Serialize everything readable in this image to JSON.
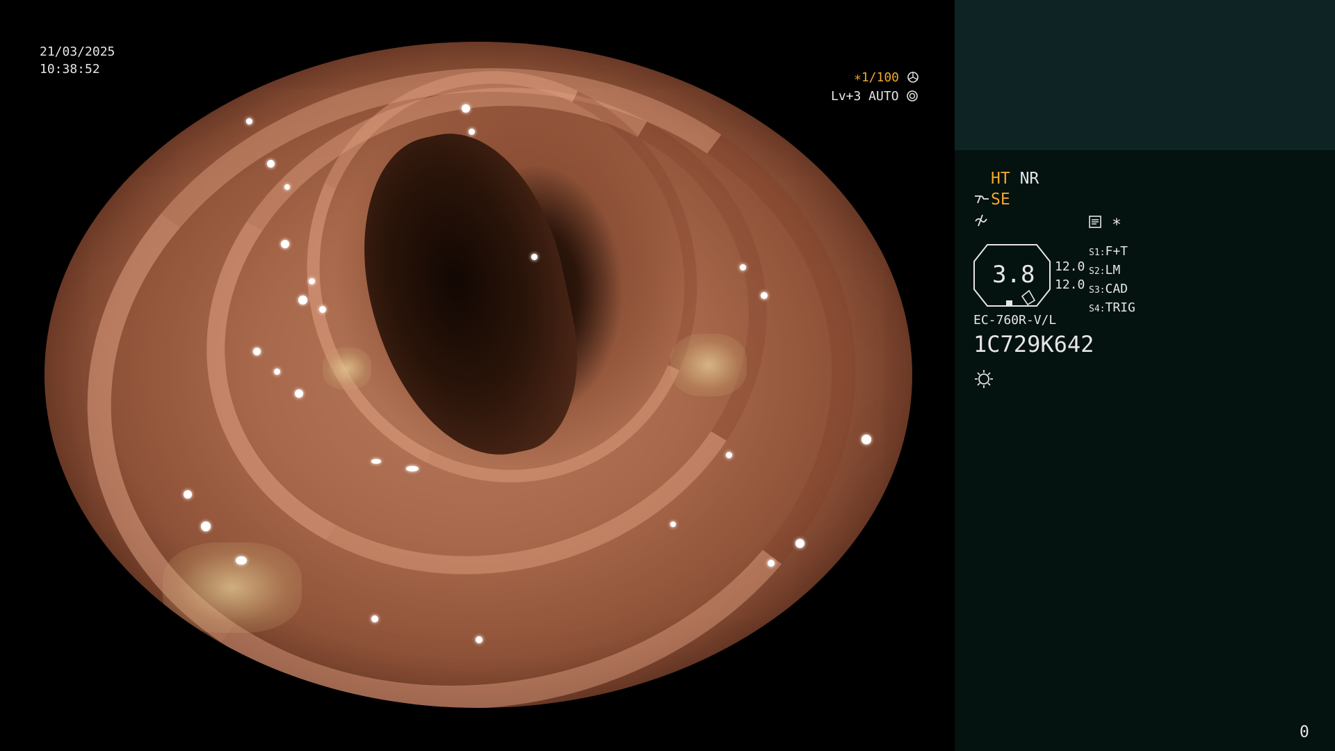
{
  "overlay": {
    "date": "21/03/2025",
    "time": "10:38:52",
    "shutter": "∗1/100",
    "level": "Lv+3 AUTO"
  },
  "panel": {
    "ht": "HT",
    "nr": "NR",
    "se": "SE",
    "gauge_value": "3.8",
    "value_top": "12.0",
    "value_bottom": "12.0",
    "switches": [
      {
        "key": "S1:",
        "value": "F+T"
      },
      {
        "key": "S2:",
        "value": "LM"
      },
      {
        "key": "S3:",
        "value": "CAD"
      },
      {
        "key": "S4:",
        "value": "TRIG"
      }
    ],
    "scope_model": "EC-760R-V/L",
    "serial": "1C729K642",
    "counter": "0"
  },
  "colors": {
    "accent": "#f2a72c",
    "panel_bg": "#041210",
    "panel_top_bg": "#0d2324",
    "text": "#e6e6e6"
  },
  "icons": [
    "shutter-icon",
    "auto-iris-icon",
    "scope-icon",
    "signal-off-icon",
    "memo-icon",
    "asterisk-icon",
    "light-icon"
  ]
}
